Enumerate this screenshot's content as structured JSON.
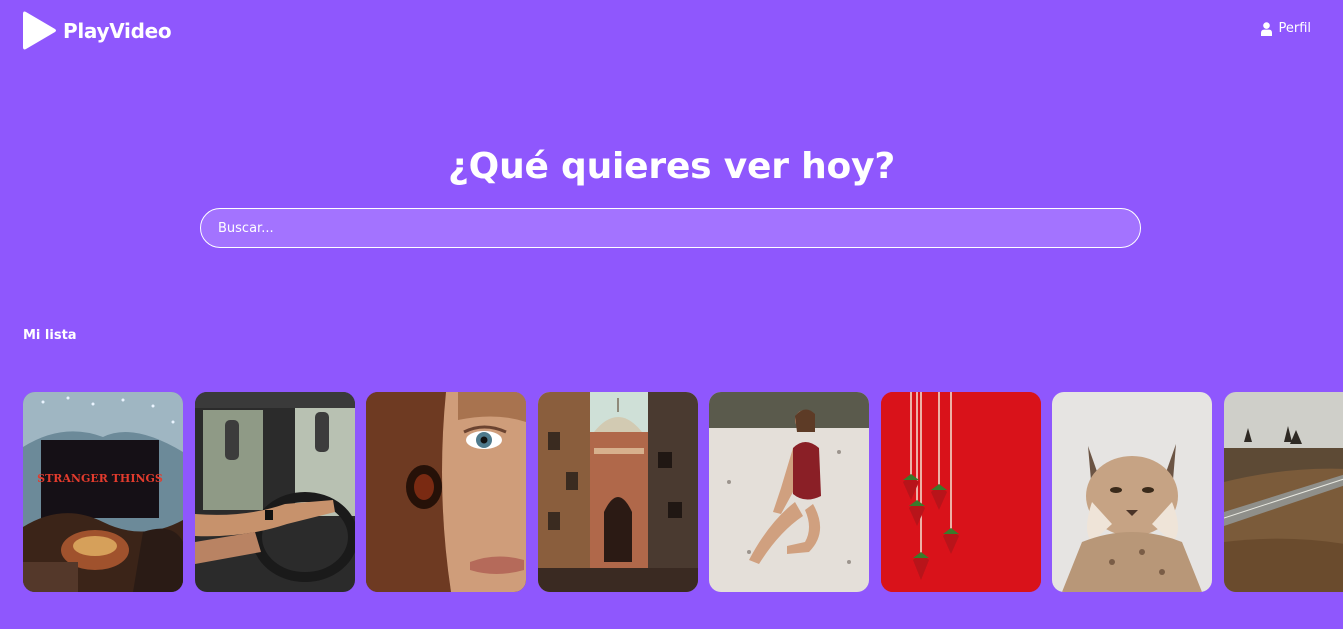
{
  "header": {
    "brand": "PlayVideo",
    "logo_icon": "play-triangle-icon",
    "profile_label": "Perfil",
    "profile_icon": "user-icon"
  },
  "hero": {
    "title": "¿Qué quieres ver hoy?",
    "search_placeholder": "Buscar..."
  },
  "my_list": {
    "title": "Mi lista",
    "items": [
      {
        "poster": "stranger-things-sign-poster",
        "text": "STRANGER THINGS"
      },
      {
        "poster": "truck-driver-steering-wheel-poster"
      },
      {
        "poster": "face-with-horse-eye-poster"
      },
      {
        "poster": "old-city-street-dome-poster"
      },
      {
        "poster": "woman-on-beach-poster"
      },
      {
        "poster": "strawberries-on-red-poster"
      },
      {
        "poster": "lynx-in-snow-poster"
      },
      {
        "poster": "highway-landscape-poster"
      }
    ]
  },
  "colors": {
    "background": "#8f57fd",
    "search_fill": "#a373ff",
    "text": "#ffffff"
  }
}
